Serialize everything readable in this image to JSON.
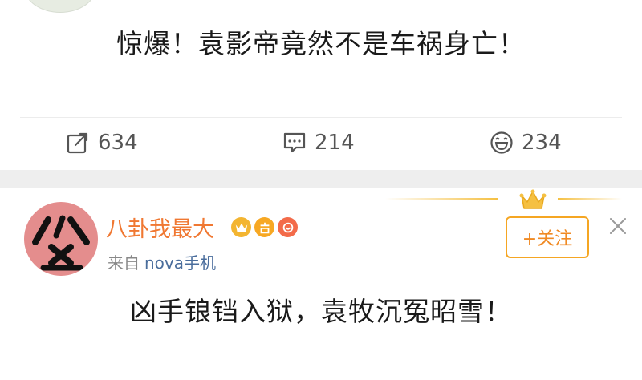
{
  "post1": {
    "text": "惊爆！袁影帝竟然不是车祸身亡！",
    "actions": {
      "repost_count": "634",
      "comment_count": "214",
      "like_count": "234"
    }
  },
  "post2": {
    "username": "八卦我最大",
    "source_prefix": "来自",
    "source_device": "nova手机",
    "follow_label": "+关注",
    "text": "凶手锒铛入狱，袁牧沉冤昭雪！"
  },
  "colors": {
    "username": "#f07832",
    "follow_border": "#f5a623",
    "link": "#4a6d9c",
    "separator": "#eeeeee"
  },
  "icons": [
    "repost-icon",
    "comment-icon",
    "like-icon",
    "vip-crown-icon",
    "answer-badge-icon",
    "fan-badge-icon",
    "close-icon"
  ]
}
